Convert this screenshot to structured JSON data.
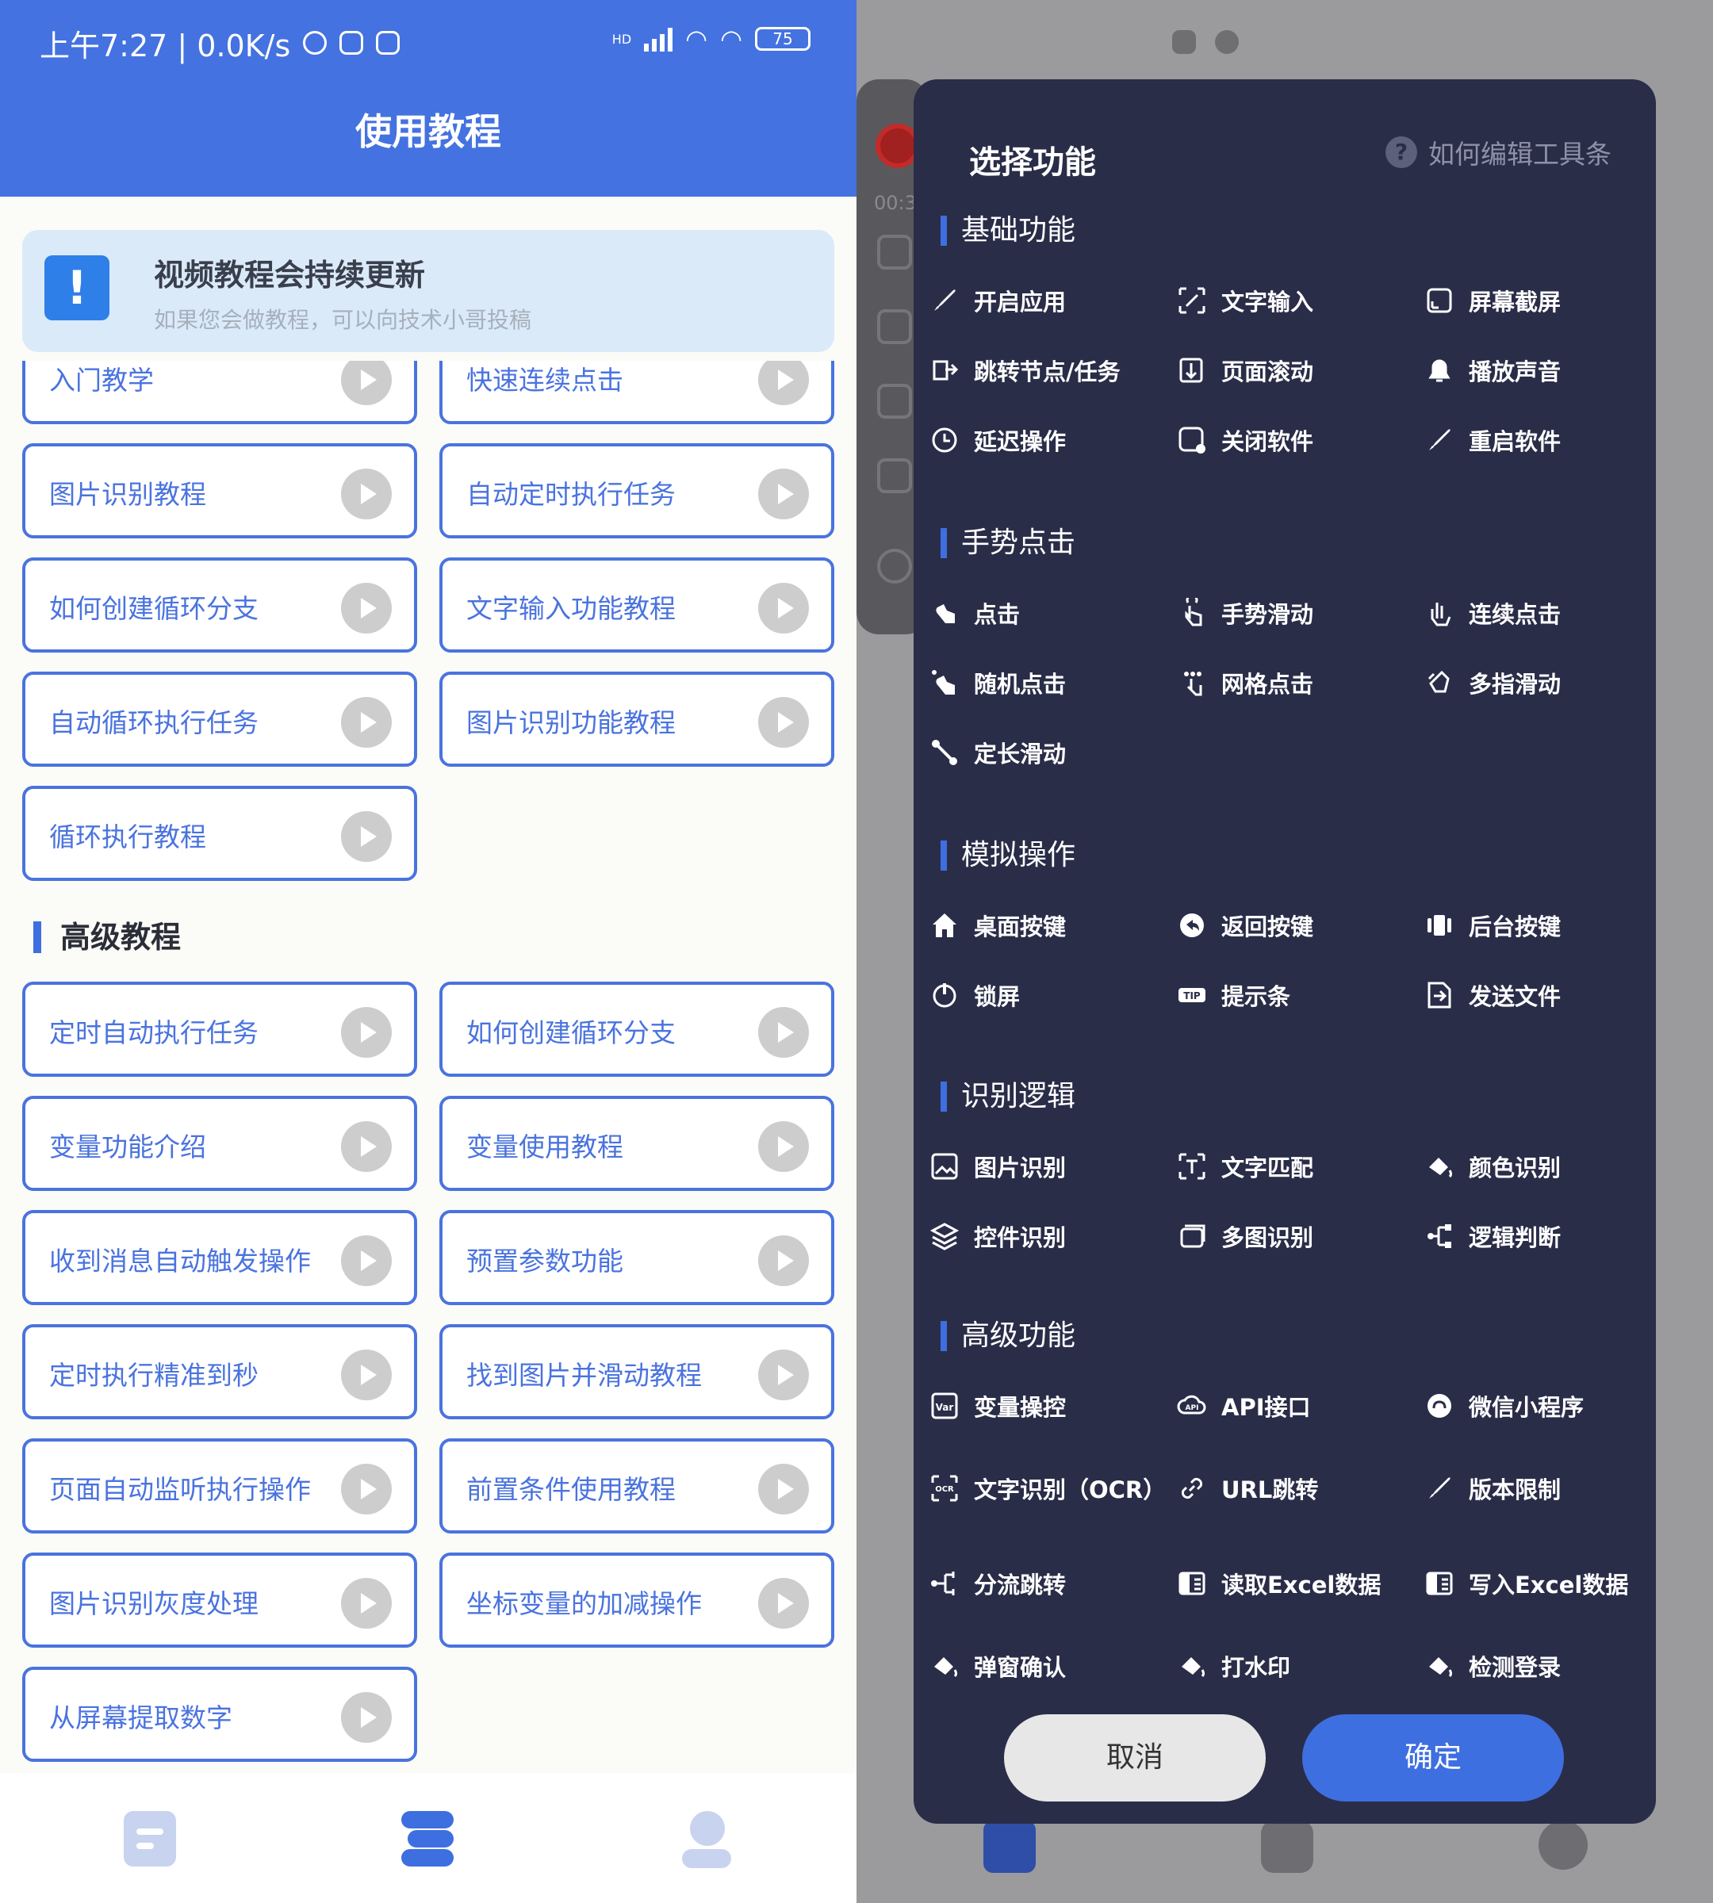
{
  "left": {
    "status": {
      "time": "上午7:27 | 0.0K/s",
      "battery": "75",
      "hd": "HD"
    },
    "title": "使用教程",
    "notice": {
      "heading": "视频教程会持续更新",
      "sub": "如果您会做教程，可以向技术小哥投稿"
    },
    "basic_cards": [
      "入门教学",
      "快速连续点击",
      "图片识别教程",
      "自动定时执行任务",
      "如何创建循环分支",
      "文字输入功能教程",
      "自动循环执行任务",
      "图片识别功能教程",
      "循环执行教程"
    ],
    "advanced_title": "高级教程",
    "advanced_cards": [
      "定时自动执行任务",
      "如何创建循环分支",
      "变量功能介绍",
      "变量使用教程",
      "收到消息自动触发操作",
      "预置参数功能",
      "定时执行精准到秒",
      "找到图片并滑动教程",
      "页面自动监听执行操作",
      "前置条件使用教程",
      "图片识别灰度处理",
      "坐标变量的加减操作",
      "从屏幕提取数字"
    ]
  },
  "right": {
    "float_time": "00:3",
    "panel": {
      "title": "选择功能",
      "help": "如何编辑工具条",
      "groups": [
        {
          "title": "基础功能",
          "items": [
            {
              "label": "开启应用",
              "icon": "rocket-icon"
            },
            {
              "label": "文字输入",
              "icon": "text-input-icon"
            },
            {
              "label": "屏幕截屏",
              "icon": "screenshot-icon"
            },
            {
              "label": "跳转节点/任务",
              "icon": "jump-icon"
            },
            {
              "label": "页面滚动",
              "icon": "scroll-icon"
            },
            {
              "label": "播放声音",
              "icon": "bell-icon"
            },
            {
              "label": "延迟操作",
              "icon": "clock-icon"
            },
            {
              "label": "关闭软件",
              "icon": "close-app-icon"
            },
            {
              "label": "重启软件",
              "icon": "rocket-icon"
            }
          ]
        },
        {
          "title": "手势点击",
          "items": [
            {
              "label": "点击",
              "icon": "tap-icon"
            },
            {
              "label": "手势滑动",
              "icon": "swipe-icon"
            },
            {
              "label": "连续点击",
              "icon": "multi-tap-icon"
            },
            {
              "label": "随机点击",
              "icon": "random-tap-icon"
            },
            {
              "label": "网格点击",
              "icon": "grid-tap-icon"
            },
            {
              "label": "多指滑动",
              "icon": "multi-finger-icon"
            },
            {
              "label": "定长滑动",
              "icon": "fixed-swipe-icon"
            }
          ]
        },
        {
          "title": "模拟操作",
          "items": [
            {
              "label": "桌面按键",
              "icon": "home-icon"
            },
            {
              "label": "返回按键",
              "icon": "back-icon"
            },
            {
              "label": "后台按键",
              "icon": "recents-icon"
            },
            {
              "label": "锁屏",
              "icon": "power-icon"
            },
            {
              "label": "提示条",
              "icon": "tip-icon"
            },
            {
              "label": "发送文件",
              "icon": "send-file-icon"
            }
          ]
        },
        {
          "title": "识别逻辑",
          "items": [
            {
              "label": "图片识别",
              "icon": "image-recognition-icon"
            },
            {
              "label": "文字匹配",
              "icon": "text-match-icon"
            },
            {
              "label": "颜色识别",
              "icon": "paint-bucket-icon"
            },
            {
              "label": "控件识别",
              "icon": "layers-icon"
            },
            {
              "label": "多图识别",
              "icon": "multi-image-icon"
            },
            {
              "label": "逻辑判断",
              "icon": "branch-icon"
            }
          ]
        },
        {
          "title": "高级功能",
          "items": [
            {
              "label": "变量操控",
              "icon": "var-icon"
            },
            {
              "label": "API接口",
              "icon": "api-icon"
            },
            {
              "label": "微信小程序",
              "icon": "mini-program-icon"
            },
            {
              "label": "文字识别（OCR）",
              "icon": "ocr-icon"
            },
            {
              "label": "URL跳转",
              "icon": "link-icon"
            },
            {
              "label": "版本限制",
              "icon": "rocket-icon"
            },
            {
              "label": "分流跳转",
              "icon": "split-icon"
            },
            {
              "label": "读取Excel数据",
              "icon": "excel-read-icon"
            },
            {
              "label": "写入Excel数据",
              "icon": "excel-write-icon"
            },
            {
              "label": "弹窗确认",
              "icon": "paint-bucket-icon"
            },
            {
              "label": "打水印",
              "icon": "paint-bucket-icon"
            },
            {
              "label": "检测登录",
              "icon": "paint-bucket-icon"
            }
          ]
        }
      ],
      "cancel": "取消",
      "confirm": "确定"
    }
  }
}
